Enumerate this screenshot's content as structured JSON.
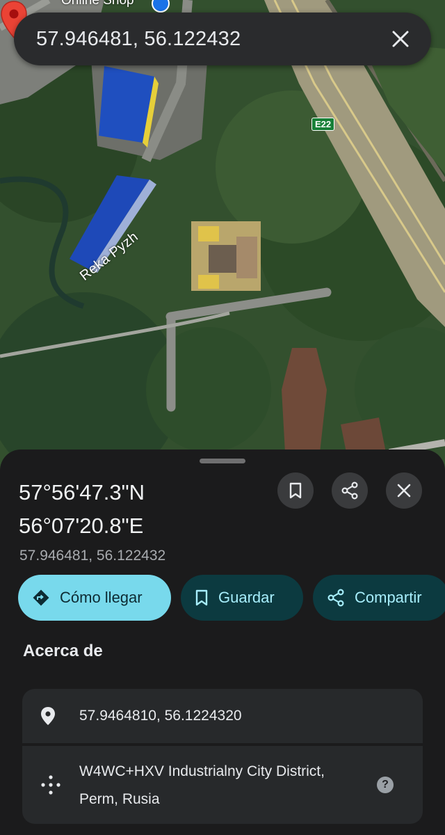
{
  "map": {
    "shop_label": "Online Shop",
    "river_label": "Reka Pyzh",
    "highway_shield": "E22"
  },
  "search": {
    "query": "57.946481, 56.122432"
  },
  "place": {
    "title_lat": "57°56'47.3\"N",
    "title_lng": "56°07'20.8\"E",
    "decimal": "57.946481, 56.122432"
  },
  "actions": {
    "directions_label": "Cómo llegar",
    "save_label": "Guardar",
    "share_label": "Compartir"
  },
  "about": {
    "title": "Acerca de",
    "coordinates": "57.9464810, 56.1224320",
    "plus_code": "W4WC+HXV Industrialny City District, Perm, Rusia",
    "help_glyph": "?"
  },
  "colors": {
    "primary_pill": "#78d9ec",
    "secondary_pill": "#0c3a40",
    "pin": "#ea4335",
    "sheet_bg": "#1b1b1c"
  },
  "icons": [
    "close-icon",
    "bookmark-icon",
    "share-icon",
    "directions-icon",
    "location-pin-icon",
    "plus-code-icon",
    "help-icon"
  ]
}
